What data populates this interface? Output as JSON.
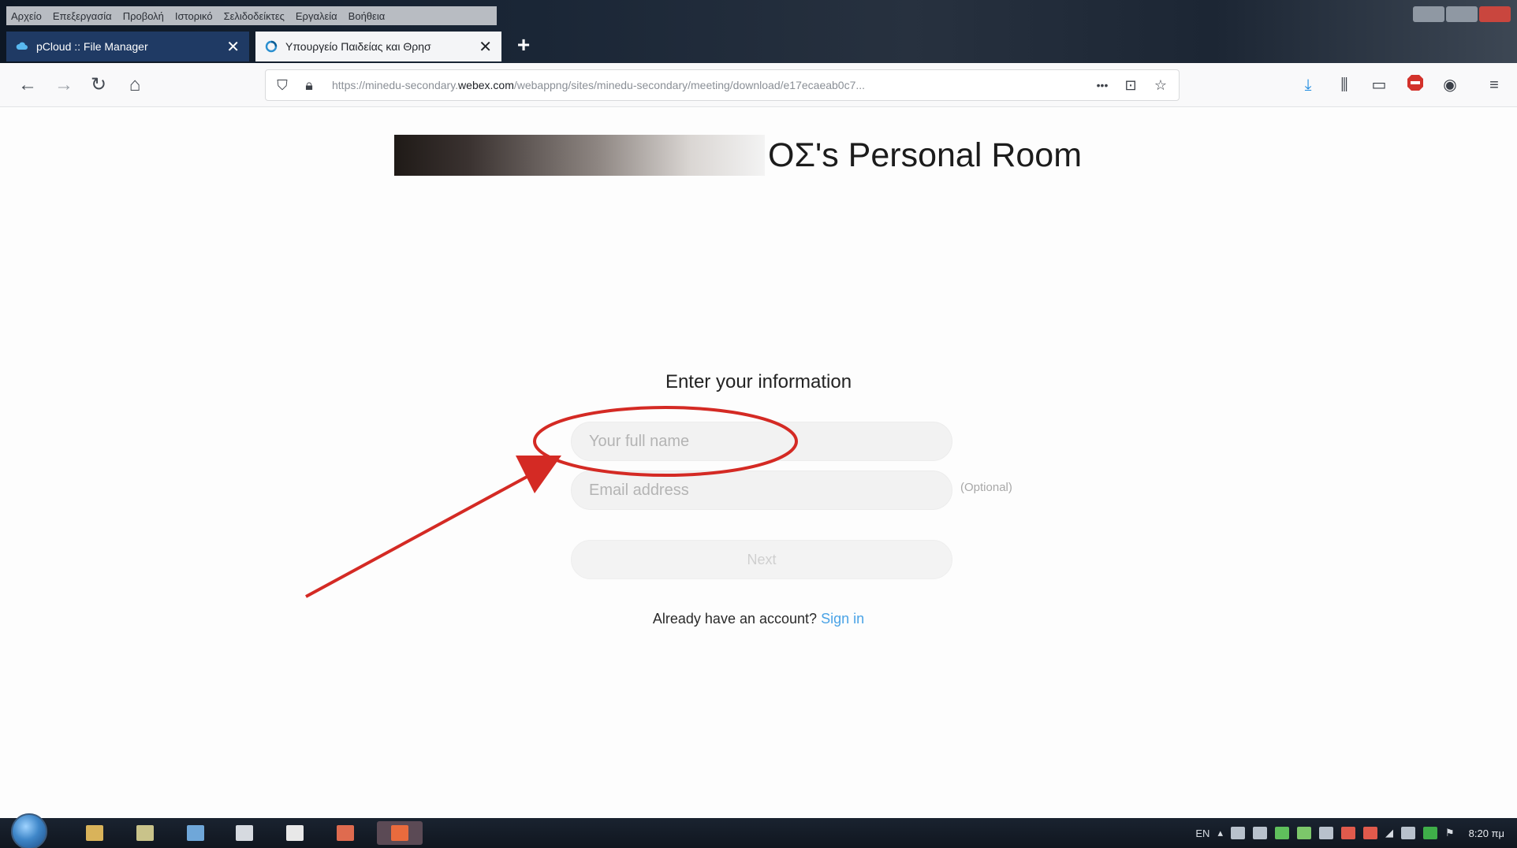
{
  "browser": {
    "menu_items": [
      "Αρχείο",
      "Επεξεργασία",
      "Προβολή",
      "Ιστορικό",
      "Σελιδοδείκτες",
      "Εργαλεία",
      "Βοήθεια"
    ],
    "tabs": [
      {
        "label": "pCloud :: File Manager",
        "close": "✕",
        "active": false
      },
      {
        "label": "Υπουργείο Παιδείας και Θρησ",
        "close": "✕",
        "active": true
      }
    ],
    "new_tab": "+",
    "url_prefix": "https://minedu-secondary.",
    "url_domain": "webex.com",
    "url_suffix": "/webappng/sites/minedu-secondary/meeting/download/e17ecaeab0c7...",
    "url_more": "•••",
    "colors": {
      "tab_inactive": "#1f3a64",
      "tab_active": "#f4f5f7"
    }
  },
  "page": {
    "room_title": "ΟΣ's Personal Room",
    "form_heading": "Enter your information",
    "name_placeholder": "Your full name",
    "email_placeholder": "Email address",
    "optional_label": "(Optional)",
    "next_label": "Next",
    "account_prompt": "Already have an account?",
    "sign_in_label": "Sign in",
    "colors": {
      "link": "#4aa3e6",
      "annotation": "#d42a24"
    }
  },
  "taskbar": {
    "language": "EN",
    "clock": "8:20 πμ"
  }
}
